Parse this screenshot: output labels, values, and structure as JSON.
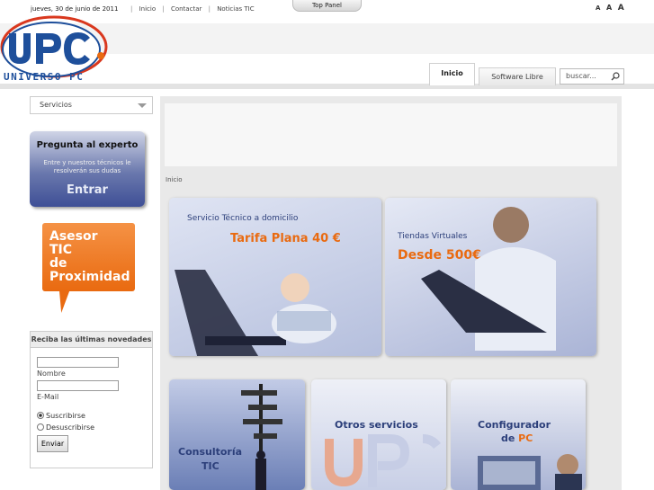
{
  "topbar": {
    "date": "jueves, 30 de junio de 2011",
    "nav": [
      "Inicio",
      "Contactar",
      "Noticias TIC"
    ],
    "panel_label": "Top Panel",
    "font_sizes": [
      "A",
      "A",
      "A"
    ]
  },
  "logo": {
    "initials": "UPC",
    "name": "UNIVERSO PC"
  },
  "tabs": [
    {
      "label": "Inicio",
      "active": true
    },
    {
      "label": "Software Libre",
      "active": false
    }
  ],
  "search": {
    "placeholder": "buscar..."
  },
  "sidebar": {
    "servicios_label": "Servicios",
    "experto": {
      "title": "Pregunta al experto",
      "subtitle": "Entre y nuestros técnicos le resolverán sus dudas",
      "cta": "Entrar"
    },
    "asesor": {
      "lines": [
        "Asesor",
        "TIC",
        "de",
        "Proximidad"
      ]
    },
    "newsletter": {
      "title": "Reciba las últimas novedades",
      "name_label": "Nombre",
      "email_label": "E-Mail",
      "subscribe_label": "Suscribirse",
      "unsubscribe_label": "Desuscribirse",
      "submit_label": "Enviar"
    }
  },
  "main": {
    "breadcrumb": "Inicio",
    "panels": {
      "servicio": {
        "title": "Servicio Técnico a domicilio",
        "price": "Tarifa Plana 40 €"
      },
      "tiendas": {
        "title": "Tiendas Virtuales",
        "price": "Desde 500€"
      },
      "consultoria": {
        "line1": "Consultoría",
        "line2": "TIC"
      },
      "otros": {
        "title": "Otros servicios"
      },
      "configurador": {
        "line1": "Configurador",
        "line2_prefix": "de ",
        "line2_accent": "PC"
      }
    }
  },
  "colors": {
    "brand_blue": "#1e4f9b",
    "accent_orange": "#e96a10",
    "logo_red": "#d9381e"
  }
}
